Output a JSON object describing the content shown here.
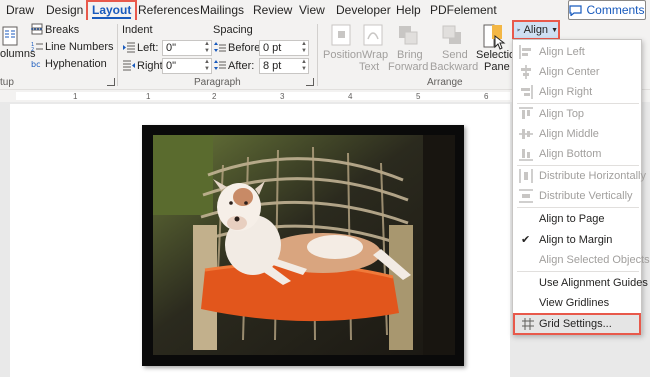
{
  "tabs": [
    "Draw",
    "Design",
    "Layout",
    "References",
    "Mailings",
    "Review",
    "View",
    "Developer",
    "Help",
    "PDFelement"
  ],
  "active_tab": "Layout",
  "comments_label": "Comments",
  "page_setup": {
    "columns_label": "olumns",
    "breaks_label": "Breaks",
    "line_numbers_label": "Line Numbers",
    "hyphenation_label": "Hyphenation",
    "group_label": "tup"
  },
  "paragraph": {
    "indent_label": "Indent",
    "spacing_label": "Spacing",
    "left_label": "Left:",
    "right_label": "Right:",
    "before_label": "Before:",
    "after_label": "After:",
    "left_value": "0\"",
    "right_value": "0\"",
    "before_value": "0 pt",
    "after_value": "8 pt",
    "group_label": "Paragraph"
  },
  "arrange": {
    "position_label": "Position",
    "wrap_text_label_1": "Wrap",
    "wrap_text_label_2": "Text",
    "bring_forward_label_1": "Bring",
    "bring_forward_label_2": "Forward",
    "send_backward_label_1": "Send",
    "send_backward_label_2": "Backward",
    "selection_pane_label_1": "Selection",
    "selection_pane_label_2": "Pane",
    "align_label": "Align",
    "group_label": "Arrange"
  },
  "ruler_ticks": [
    "1",
    "1",
    "2",
    "3",
    "4",
    "5",
    "6"
  ],
  "align_menu": {
    "align_left": "Align Left",
    "align_center": "Align Center",
    "align_right": "Align Right",
    "align_top": "Align Top",
    "align_middle": "Align Middle",
    "align_bottom": "Align Bottom",
    "distribute_horizontally": "Distribute Horizontally",
    "distribute_vertically": "Distribute Vertically",
    "align_to_page": "Align to Page",
    "align_to_margin": "Align to Margin",
    "align_selected_objects": "Align Selected Objects",
    "use_alignment_guides": "Use Alignment Guides",
    "view_gridlines": "View Gridlines",
    "grid_settings": "Grid Settings..."
  },
  "colors": {
    "accent_blue": "#185abd",
    "highlight_red": "#e8594b",
    "cushion_orange": "#e2561c"
  }
}
